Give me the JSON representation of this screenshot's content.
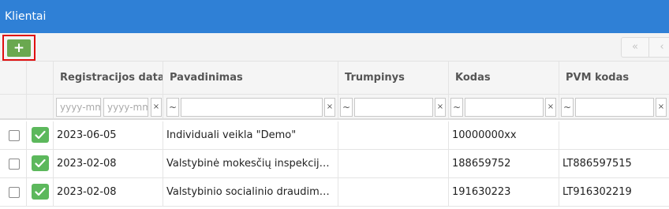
{
  "window": {
    "title": "Klientai"
  },
  "toolbar": {
    "add_label": "+",
    "pager_first": "«",
    "pager_prev": "‹"
  },
  "columns": [
    "Registracijos data",
    "Pavadinimas",
    "Trumpinys",
    "Kodas",
    "PVM kodas"
  ],
  "filters": {
    "date_from_placeholder": "yyyy-mm-dd",
    "date_to_placeholder": "yyyy-mm-dd",
    "operator": "~",
    "clear": "×"
  },
  "rows": [
    {
      "date": "2023-06-05",
      "name": "Individuali veikla \"Demo\"",
      "short": "",
      "code": "10000000xx",
      "vat": ""
    },
    {
      "date": "2023-02-08",
      "name": "Valstybinė mokesčių inspekcija prie Lietuvos Respublikos finansų ministerijos",
      "short": "",
      "code": "188659752",
      "vat": "LT886597515"
    },
    {
      "date": "2023-02-08",
      "name": "Valstybinio socialinio draudimo fondo valdyba",
      "short": "",
      "code": "191630223",
      "vat": "LT916302219"
    }
  ]
}
